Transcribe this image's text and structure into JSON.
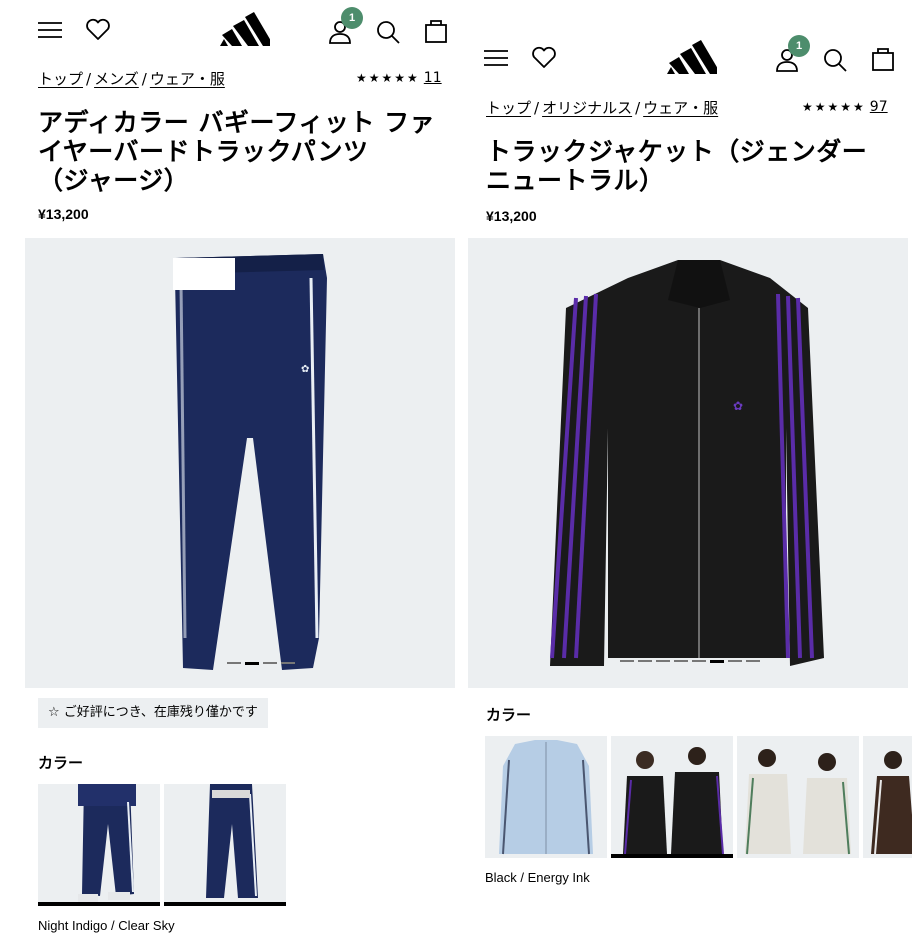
{
  "left": {
    "badge_count": "1",
    "breadcrumbs": [
      "トップ",
      "メンズ",
      "ウェア・服"
    ],
    "breadcrumb_sep": "/",
    "stars": "★★★★★",
    "review_count": "11",
    "title_lines": [
      "アディカラー バギーフィット ファ",
      "イヤーバードトラックパンツ",
      "（ジャージ）"
    ],
    "price": "¥13,200",
    "stock_icon": "☆",
    "stock_message": "ご好評につき、在庫残り僅かです",
    "color_label": "カラー",
    "selected_color": "Night Indigo / Clear Sky",
    "product_color": "#1c2a5c",
    "stripe_color": "#e8eef5"
  },
  "right": {
    "badge_count": "1",
    "breadcrumbs": [
      "トップ",
      "オリジナルス",
      "ウェア・服"
    ],
    "breadcrumb_sep": "/",
    "stars": "★★★★★",
    "review_count": "97",
    "title_lines": [
      "トラックジャケット（ジェンダー",
      "ニュートラル）"
    ],
    "price": "¥13,200",
    "color_label": "カラー",
    "selected_color": "Black / Energy Ink",
    "product_color": "#1a1a1a",
    "stripe_color": "#5a2ca8"
  },
  "colors": {
    "accent_badge": "#4d8d6c",
    "hero_bg": "#eceff1"
  }
}
